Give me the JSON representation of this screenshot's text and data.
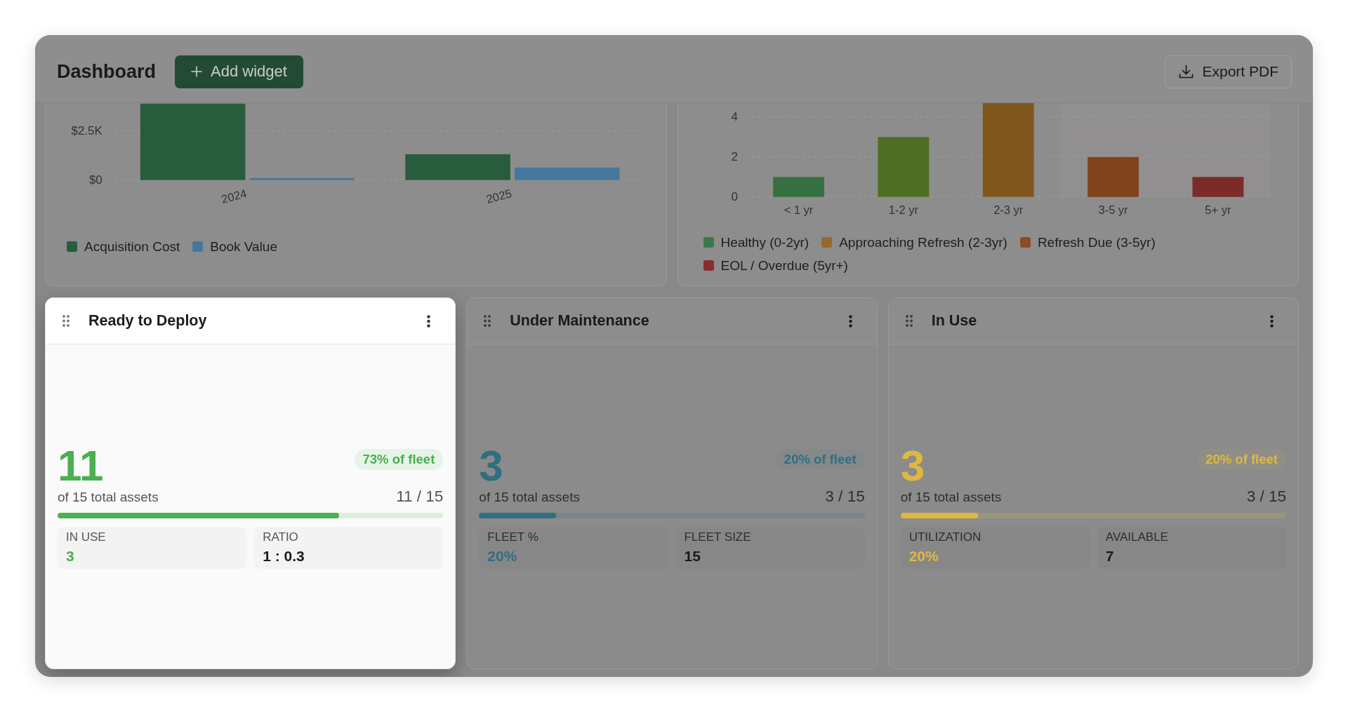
{
  "header": {
    "title": "Dashboard",
    "add_button": "Add widget",
    "export_button": "Export PDF"
  },
  "chart_panels": [
    {
      "chart_data": {
        "type": "bar",
        "categories": [
          "2024",
          "2025"
        ],
        "series": [
          {
            "name": "Acquisition Cost",
            "color": "#285c3c",
            "values": [
              3900,
              1320
            ]
          },
          {
            "name": "Book Value",
            "color": "#45789c",
            "values": [
              100,
              640
            ]
          }
        ],
        "ylim": [
          0,
          3900
        ],
        "yticks": [
          {
            "value": 0,
            "label": "$0"
          },
          {
            "value": 2500,
            "label": "$2.5K"
          }
        ]
      }
    },
    {
      "chart_data": {
        "type": "bar",
        "categories": [
          "< 1 yr",
          "1-2 yr",
          "2-3 yr",
          "3-5 yr",
          "5+ yr"
        ],
        "series": [
          {
            "values": [
              1,
              3,
              4.7,
              2,
              1
            ],
            "colors": [
              "#367040",
              "#506e23",
              "#80581e",
              "#80431e",
              "#7b2c28"
            ]
          }
        ],
        "ylim": [
          0,
          4.7
        ],
        "yticks": [
          0,
          2,
          4
        ]
      },
      "shaded_region": true,
      "legend": [
        {
          "label": "Healthy (0-2yr)",
          "color": "#3c7846"
        },
        {
          "label": "Approaching Refresh (2-3yr)",
          "color": "#96692d"
        },
        {
          "label": "Refresh Due (3-5yr)",
          "color": "#8c4b23"
        },
        {
          "label": "EOL / Overdue (5yr+)",
          "color": "#872d2d"
        }
      ]
    }
  ],
  "widgets": [
    {
      "title": "Ready to Deploy",
      "selected": true,
      "color": "#4caf50",
      "value": "11",
      "badge": "73% of fleet",
      "caption": "of 15 total assets",
      "fraction": "11 / 15",
      "level": 0.73,
      "stats": [
        {
          "label": "IN USE",
          "value": "3",
          "accent": true
        },
        {
          "label": "RATIO",
          "value": "1 : 0.3",
          "accent": false
        }
      ]
    },
    {
      "title": "Under Maintenance",
      "selected": false,
      "color": "#2f6f80",
      "value": "3",
      "badge": "20% of fleet",
      "caption": "of 15 total assets",
      "fraction": "3 / 15",
      "level": 0.2,
      "stats": [
        {
          "label": "FLEET %",
          "value": "20%",
          "accent": true
        },
        {
          "label": "FLEET SIZE",
          "value": "15",
          "accent": false
        }
      ]
    },
    {
      "title": "In Use",
      "selected": false,
      "color": "#e0b840",
      "value": "3",
      "badge": "20% of fleet",
      "caption": "of 15 total assets",
      "fraction": "3 / 15",
      "level": 0.2,
      "stats": [
        {
          "label": "UTILIZATION",
          "value": "20%",
          "accent": true
        },
        {
          "label": "AVAILABLE",
          "value": "7",
          "accent": false
        }
      ]
    }
  ]
}
